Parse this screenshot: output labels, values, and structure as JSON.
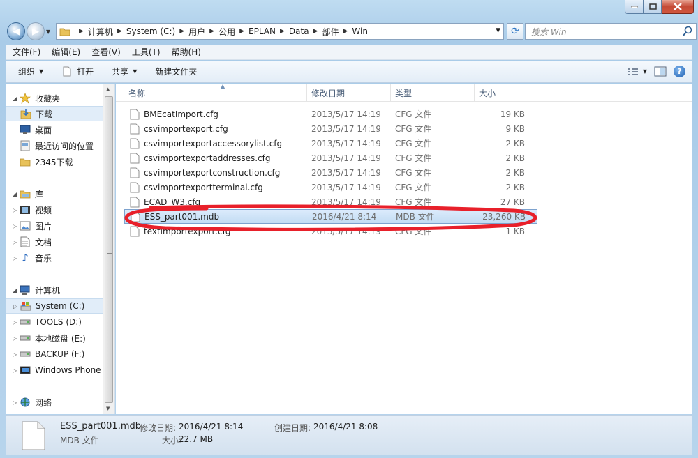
{
  "address": {
    "crumbs": [
      "计算机",
      "System (C:)",
      "用户",
      "公用",
      "EPLAN",
      "Data",
      "部件",
      "Win"
    ],
    "search_placeholder": "搜索 Win"
  },
  "menu": [
    "文件(F)",
    "编辑(E)",
    "查看(V)",
    "工具(T)",
    "帮助(H)"
  ],
  "commands": {
    "organize": "组织",
    "open": "打开",
    "share": "共享",
    "new_folder": "新建文件夹"
  },
  "nav": {
    "favorites": "收藏夹",
    "downloads": "下载",
    "desktop": "桌面",
    "recent": "最近访问的位置",
    "dl2345": "2345下载",
    "libraries": "库",
    "videos": "视频",
    "pictures": "图片",
    "documents": "文档",
    "music": "音乐",
    "computer": "计算机",
    "drive_c": "System (C:)",
    "drive_d": "TOOLS (D:)",
    "drive_e": "本地磁盘 (E:)",
    "drive_f": "BACKUP (F:)",
    "windows_phone": "Windows Phone",
    "network": "网络"
  },
  "columns": {
    "name": "名称",
    "date": "修改日期",
    "type": "类型",
    "size": "大小"
  },
  "files": [
    {
      "name": "BMEcatImport.cfg",
      "date": "2013/5/17 14:19",
      "type": "CFG 文件",
      "size": "19 KB"
    },
    {
      "name": "csvimportexport.cfg",
      "date": "2013/5/17 14:19",
      "type": "CFG 文件",
      "size": "9 KB"
    },
    {
      "name": "csvimportexportaccessorylist.cfg",
      "date": "2013/5/17 14:19",
      "type": "CFG 文件",
      "size": "2 KB"
    },
    {
      "name": "csvimportexportaddresses.cfg",
      "date": "2013/5/17 14:19",
      "type": "CFG 文件",
      "size": "2 KB"
    },
    {
      "name": "csvimportexportconstruction.cfg",
      "date": "2013/5/17 14:19",
      "type": "CFG 文件",
      "size": "2 KB"
    },
    {
      "name": "csvimportexportterminal.cfg",
      "date": "2013/5/17 14:19",
      "type": "CFG 文件",
      "size": "2 KB"
    },
    {
      "name": "ECAD_W3.cfg",
      "date": "2013/5/17 14:19",
      "type": "CFG 文件",
      "size": "27 KB"
    },
    {
      "name": "ESS_part001.mdb",
      "date": "2016/4/21 8:14",
      "type": "MDB 文件",
      "size": "23,260 KB"
    },
    {
      "name": "textimportexport.cfg",
      "date": "2013/5/17 14:19",
      "type": "CFG 文件",
      "size": "1 KB"
    }
  ],
  "details": {
    "name": "ESS_part001.mdb",
    "type": "MDB 文件",
    "modified_label": "修改日期:",
    "modified": "2016/4/21 8:14",
    "created_label": "创建日期:",
    "created": "2016/4/21 8:08",
    "size_label": "大小:",
    "size": "22.7 MB"
  },
  "colors": {
    "annotation": "#e8202a",
    "selection": "#c2dcf3"
  }
}
